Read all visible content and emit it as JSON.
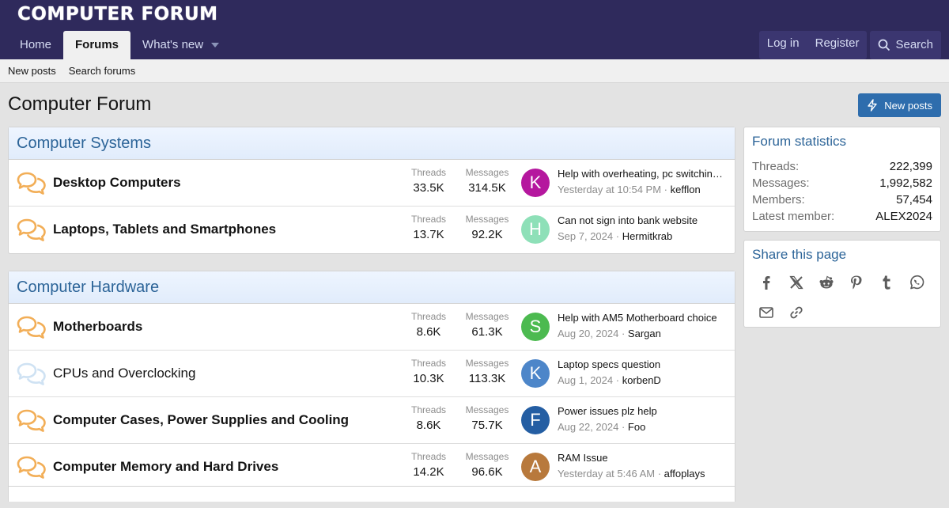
{
  "header": {
    "logo": "COMPUTER FORUM",
    "nav": [
      {
        "label": "Home"
      },
      {
        "label": "Forums"
      },
      {
        "label": "What's new"
      }
    ],
    "login": "Log in",
    "register": "Register",
    "search": "Search"
  },
  "subnav": {
    "new_posts": "New posts",
    "search_forums": "Search forums"
  },
  "page": {
    "title": "Computer Forum",
    "new_posts_button": "New posts"
  },
  "stat_labels": {
    "threads": "Threads",
    "messages": "Messages"
  },
  "categories": [
    {
      "title": "Computer Systems",
      "forums": [
        {
          "name": "Desktop Computers",
          "threads": "33.5K",
          "messages": "314.5K",
          "avatar_letter": "K",
          "avatar_color": "#b5179e",
          "last_title": "Help with overheating, pc switching …",
          "last_date": "Yesterday at 10:54 PM",
          "last_user": "kefflon",
          "unread": true
        },
        {
          "name": "Laptops, Tablets and Smartphones",
          "threads": "13.7K",
          "messages": "92.2K",
          "avatar_letter": "H",
          "avatar_color": "#8ee0b8",
          "last_title": "Can not sign into bank website",
          "last_date": "Sep 7, 2024",
          "last_user": "Hermitkrab",
          "unread": true
        }
      ]
    },
    {
      "title": "Computer Hardware",
      "forums": [
        {
          "name": "Motherboards",
          "threads": "8.6K",
          "messages": "61.3K",
          "avatar_letter": "S",
          "avatar_color": "#4cba50",
          "last_title": "Help with AM5 Motherboard choice",
          "last_date": "Aug 20, 2024",
          "last_user": "Sargan",
          "unread": true
        },
        {
          "name": "CPUs and Overclocking",
          "threads": "10.3K",
          "messages": "113.3K",
          "avatar_letter": "K",
          "avatar_color": "#4d86c9",
          "last_title": "Laptop specs question",
          "last_date": "Aug 1, 2024",
          "last_user": "korbenD",
          "unread": false
        },
        {
          "name": "Computer Cases, Power Supplies and Cooling",
          "threads": "8.6K",
          "messages": "75.7K",
          "avatar_letter": "F",
          "avatar_color": "#245ea3",
          "last_title": "Power issues plz help",
          "last_date": "Aug 22, 2024",
          "last_user": "Foo",
          "unread": true
        },
        {
          "name": "Computer Memory and Hard Drives",
          "threads": "14.2K",
          "messages": "96.6K",
          "avatar_letter": "A",
          "avatar_color": "#b8793c",
          "last_title": "RAM Issue",
          "last_date": "Yesterday at 5:46 AM",
          "last_user": "affoplays",
          "unread": true
        }
      ]
    }
  ],
  "forum_statistics": {
    "title": "Forum statistics",
    "rows": [
      {
        "label": "Threads:",
        "value": "222,399"
      },
      {
        "label": "Messages:",
        "value": "1,992,582"
      },
      {
        "label": "Members:",
        "value": "57,454"
      },
      {
        "label": "Latest member:",
        "value": "ALEX2024"
      }
    ]
  },
  "share": {
    "title": "Share this page",
    "icons": [
      "facebook-icon",
      "x-icon",
      "reddit-icon",
      "pinterest-icon",
      "tumblr-icon",
      "whatsapp-icon",
      "email-icon",
      "link-icon"
    ]
  },
  "colors": {
    "header_bg": "#2f2a5c",
    "accent": "#2c6498",
    "button": "#2e6dad",
    "unread_icon": "#f2ae57",
    "read_icon": "#cfe2f3"
  }
}
